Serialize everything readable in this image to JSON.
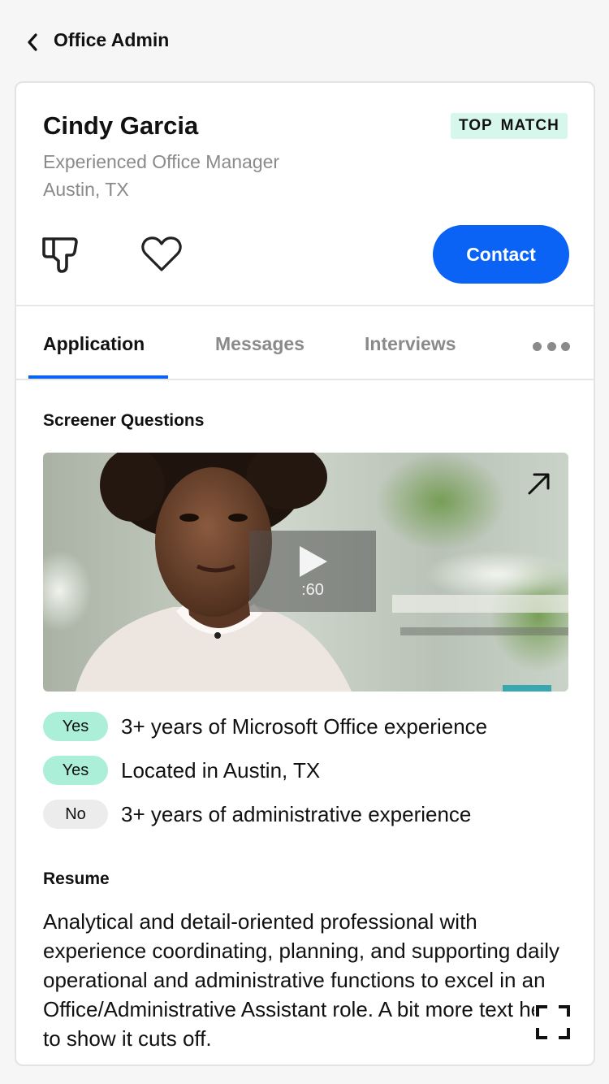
{
  "header": {
    "back_icon": "chevron-left-icon",
    "title": "Office Admin"
  },
  "candidate": {
    "name": "Cindy Garcia",
    "badge": "TOP MATCH",
    "headline": "Experienced Office Manager",
    "location": "Austin, TX",
    "actions": {
      "dislike_icon": "thumbs-down-icon",
      "favorite_icon": "heart-icon",
      "contact_label": "Contact"
    }
  },
  "tabs": [
    {
      "label": "Application",
      "active": true
    },
    {
      "label": "Messages",
      "active": false
    },
    {
      "label": "Interviews",
      "active": false
    }
  ],
  "more_icon": "more-horizontal-icon",
  "screener": {
    "title": "Screener Questions",
    "video": {
      "duration": ":60",
      "play_icon": "play-icon",
      "open_icon": "arrow-up-right-icon"
    },
    "answers": [
      {
        "answer": "Yes",
        "question": "3+ years of Microsoft Office experience"
      },
      {
        "answer": "Yes",
        "question": "Located in Austin, TX"
      },
      {
        "answer": "No",
        "question": "3+ years of administrative experience"
      }
    ]
  },
  "resume": {
    "title": "Resume",
    "text": "Analytical and detail-oriented professional with experience coordinating, planning, and supporting daily operational and administrative functions to excel in an Office/Administrative Assistant role. A bit more text here to show it cuts off.",
    "fullscreen_icon": "fullscreen-icon"
  },
  "colors": {
    "accent": "#0a63f5",
    "badge_bg": "#d8f7ec",
    "yes_pill": "#abefd8",
    "no_pill": "#ececec",
    "muted_text": "#8a8a8a"
  }
}
